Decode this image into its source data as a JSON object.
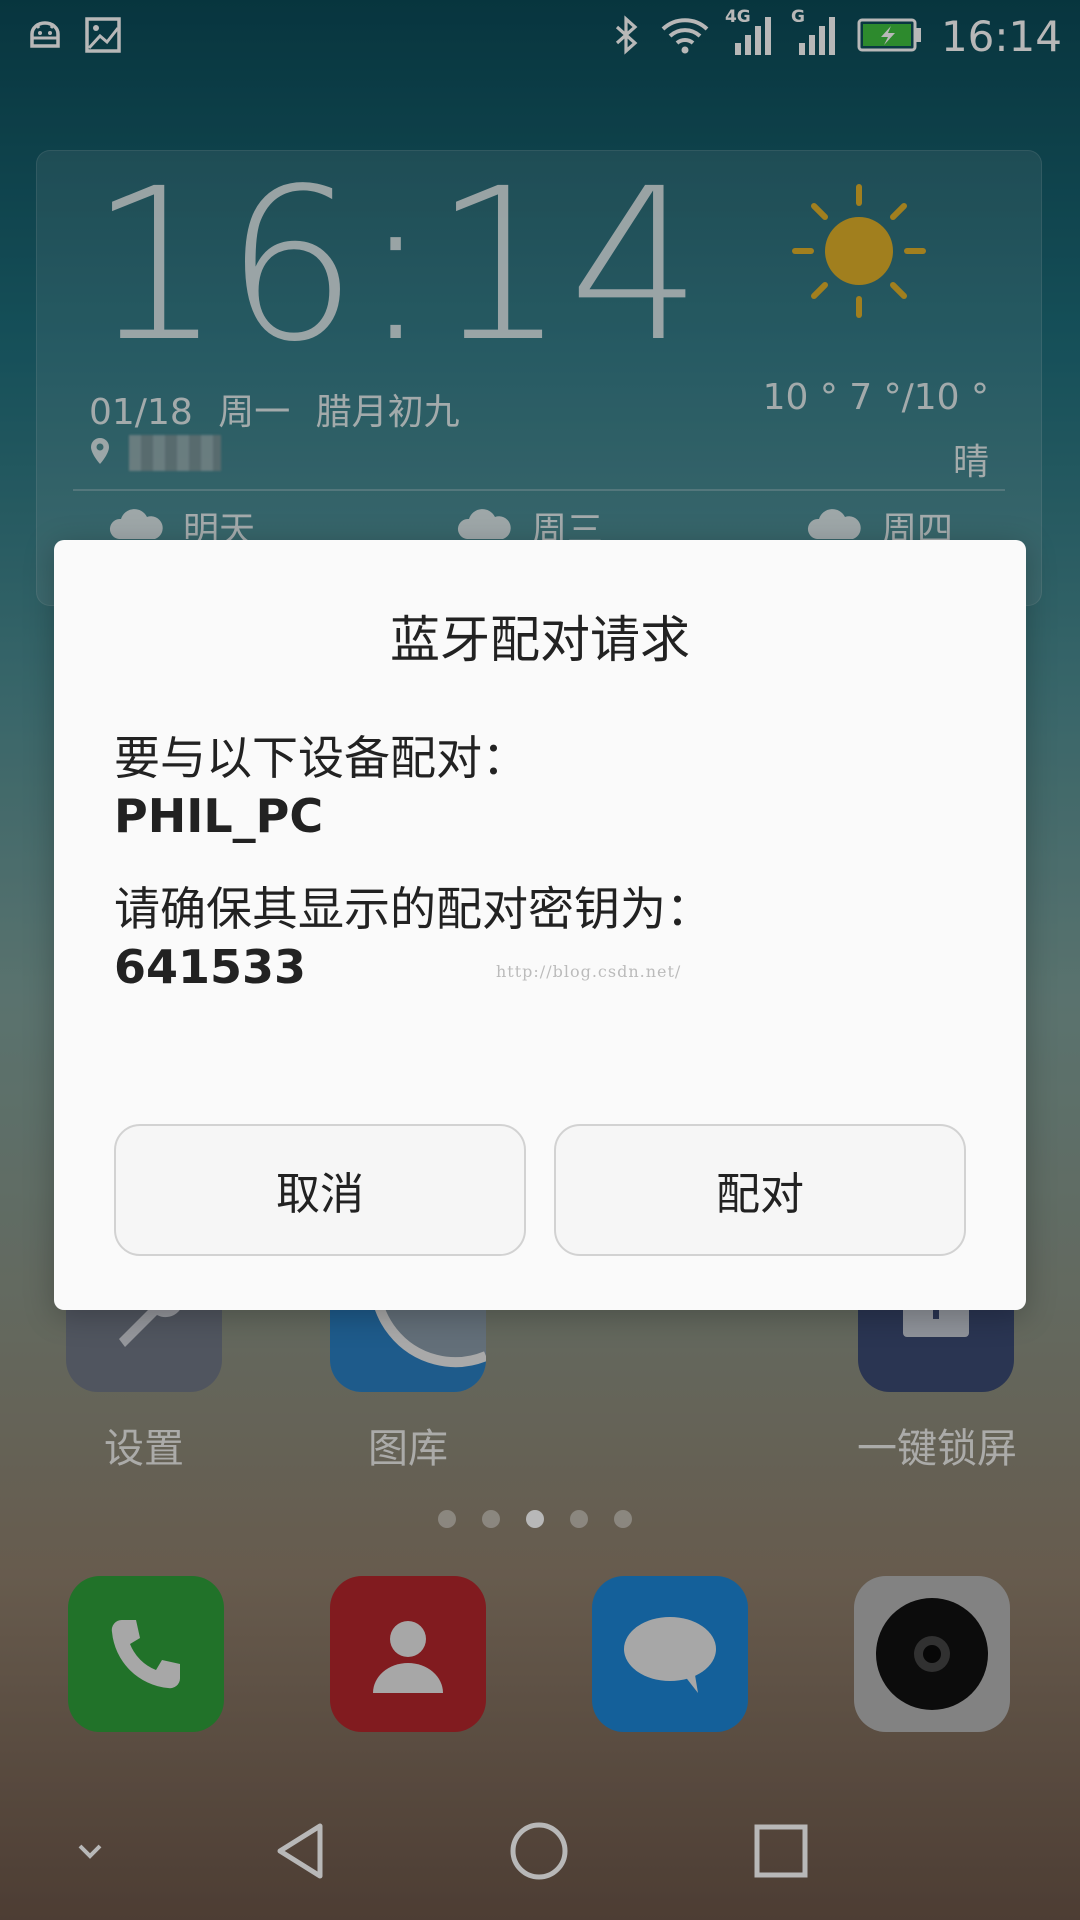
{
  "status_bar": {
    "time": "16:14",
    "network_4g": "4G",
    "network_g": "G",
    "icons": [
      "android-debug-icon",
      "image-icon",
      "bluetooth-icon",
      "wifi-icon",
      "signal-icon",
      "battery-charging-icon"
    ]
  },
  "widget": {
    "clock": "16:14",
    "date": "01/18",
    "weekday": "周一",
    "lunar_date": "腊月初九",
    "temperature": "10 ° 7 °/10 °",
    "condition": "晴",
    "forecast": [
      {
        "day": "明天"
      },
      {
        "day": "周三"
      },
      {
        "day": "周四"
      }
    ]
  },
  "home_apps": [
    {
      "label": "设置"
    },
    {
      "label": "图库"
    },
    {
      "label": "一键锁屏"
    }
  ],
  "dock_apps": [
    "phone-icon",
    "contacts-icon",
    "messages-icon",
    "camera-icon"
  ],
  "page_indicator": {
    "count": 5,
    "active_index": 2
  },
  "dialog": {
    "title": "蓝牙配对请求",
    "line1": "要与以下设备配对：",
    "device_name": "PHIL_PC",
    "line2": "请确保其显示的配对密钥为：",
    "passkey": "641533",
    "watermark": "http://blog.csdn.net/",
    "cancel_label": "取消",
    "pair_label": "配对"
  },
  "colors": {
    "dialog_bg": "#fafafa",
    "button_border": "#d2d2d2",
    "sun": "#e0b02a",
    "phone": "#2f9e3a",
    "contacts": "#b3262b",
    "messages": "#1c86d6"
  }
}
